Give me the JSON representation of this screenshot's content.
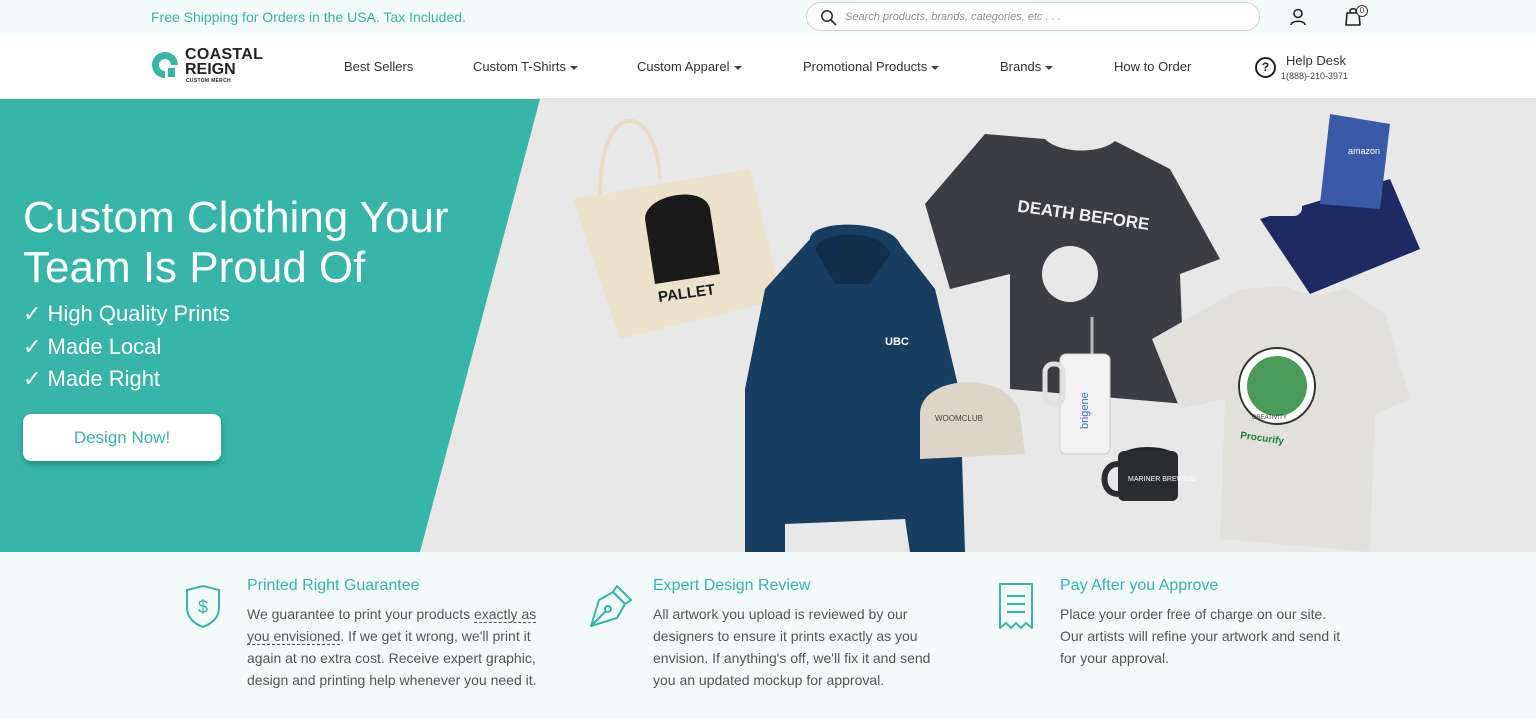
{
  "topbar": {
    "promo": "Free Shipping for Orders in the USA. Tax Included.",
    "search_placeholder": "Search products, brands, categories, etc . . .",
    "cart_count": "0"
  },
  "logo": {
    "line1": "COASTAL",
    "line2": "REIGN",
    "line3": "CUSTOM MERCH"
  },
  "nav": {
    "items": [
      {
        "label": "Best Sellers"
      },
      {
        "label": "Custom T-Shirts"
      },
      {
        "label": "Custom Apparel"
      },
      {
        "label": "Promotional Products"
      },
      {
        "label": "Brands"
      },
      {
        "label": "How to Order"
      }
    ],
    "help_title": "Help Desk",
    "help_phone": "1(888)-210-3971"
  },
  "hero": {
    "title_line1": "Custom Clothing Your",
    "title_line2": "Team Is Proud Of",
    "bullets": [
      "✓ High Quality Prints",
      "✓ Made Local",
      "✓ Made Right"
    ],
    "cta": "Design Now!",
    "product_texts": {
      "tote": "PALLET",
      "hoodie": "UBC",
      "cap": "WOOMCLUB",
      "tee_dark": "DEATH BEFORE",
      "tumbler": "brigene",
      "mug": "MARINER BREWING",
      "tee_light": "Procurify",
      "badge": "CREATIVITY",
      "box": "amazon"
    }
  },
  "features": [
    {
      "title": "Printed Right Guarantee",
      "text_before": "We guarantee to print your products ",
      "text_underlined": "exactly as you envisioned",
      "text_after": ". If we get it wrong, we'll print it again at no extra cost. Receive expert graphic, design and printing help whenever you need it."
    },
    {
      "title": "Expert Design Review",
      "text": "All artwork you upload is reviewed by our designers to ensure it prints exactly as you envision. If anything's off, we'll fix it and send you an updated mockup for approval."
    },
    {
      "title": "Pay After you Approve",
      "text": "Place your order free of charge on our site. Our artists will refine your artwork and send it for your approval."
    }
  ],
  "colors": {
    "brand_teal": "#36b5a8",
    "hoodie_navy": "#173e61",
    "tee_dark": "#3b3d42"
  },
  "icons": {
    "search": "search-icon",
    "user": "user-icon",
    "cart": "shopping-bag-icon",
    "help": "help-circle-icon",
    "feature1": "shield-dollar-icon",
    "feature2": "pen-nib-icon",
    "feature3": "receipt-icon"
  }
}
